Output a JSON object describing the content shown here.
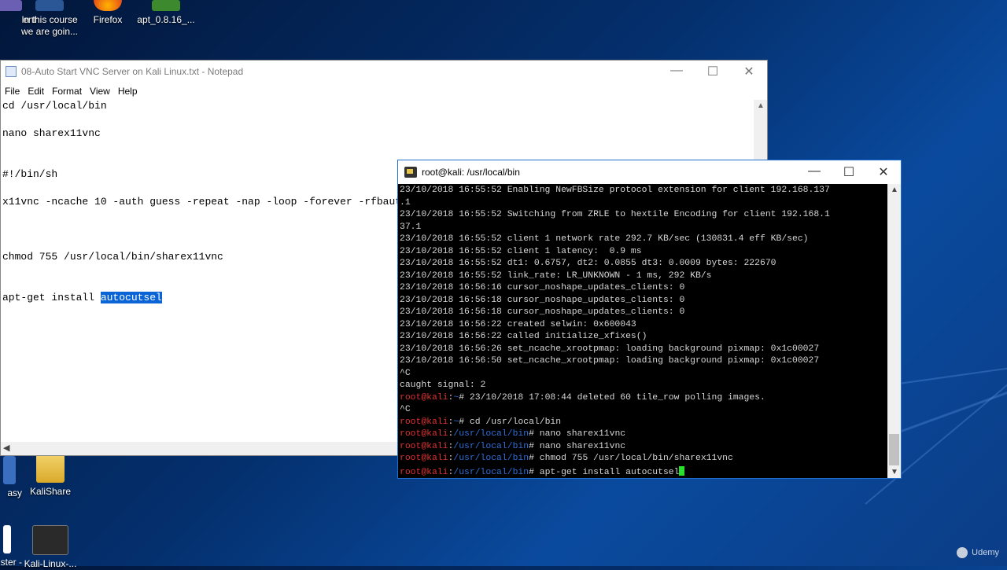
{
  "desktop": {
    "icons": [
      {
        "label": "ent",
        "icon": "document-icon"
      },
      {
        "label": "In this course we are goin...",
        "icon": "word-document-icon"
      },
      {
        "label": "Firefox",
        "icon": "firefox-icon"
      },
      {
        "label": "apt_0.8.16_...",
        "icon": "archive-icon"
      },
      {
        "label": "asy",
        "icon": "app-icon"
      },
      {
        "label": "KaliShare",
        "icon": "shared-folder-icon"
      },
      {
        "label": "ster -",
        "icon": "app-icon"
      },
      {
        "label": "Kali-Linux-...",
        "icon": "vm-image-icon"
      }
    ],
    "watermark": "Udemy"
  },
  "notepad": {
    "title": "08-Auto Start VNC Server on Kali Linux.txt - Notepad",
    "menu": [
      "File",
      "Edit",
      "Format",
      "View",
      "Help"
    ],
    "lines": [
      "cd /usr/local/bin",
      "nano sharex11vnc",
      "#!/bin/sh",
      "x11vnc -ncache 10 -auth guess -repeat -nap -loop -forever -rfbaut",
      "chmod 755 /usr/local/bin/sharex11vnc",
      "apt-get install "
    ],
    "selected_text": "autocutsel"
  },
  "terminal": {
    "title": "root@kali: /usr/local/bin",
    "log_lines": [
      "23/10/2018 16:55:52 Enabling NewFBSize protocol extension for client 192.168.137",
      ".1",
      "23/10/2018 16:55:52 Switching from ZRLE to hextile Encoding for client 192.168.1",
      "37.1",
      "23/10/2018 16:55:52 client 1 network rate 292.7 KB/sec (130831.4 eff KB/sec)",
      "23/10/2018 16:55:52 client 1 latency:  0.9 ms",
      "23/10/2018 16:55:52 dt1: 0.6757, dt2: 0.0855 dt3: 0.0009 bytes: 222670",
      "23/10/2018 16:55:52 link_rate: LR_UNKNOWN - 1 ms, 292 KB/s",
      "23/10/2018 16:56:16 cursor_noshape_updates_clients: 0",
      "23/10/2018 16:56:18 cursor_noshape_updates_clients: 0",
      "23/10/2018 16:56:18 cursor_noshape_updates_clients: 0",
      "23/10/2018 16:56:22 created selwin: 0x600043",
      "23/10/2018 16:56:22 called initialize_xfixes()",
      "23/10/2018 16:56:26 set_ncache_xrootpmap: loading background pixmap: 0x1c00027",
      "23/10/2018 16:56:50 set_ncache_xrootpmap: loading background pixmap: 0x1c00027",
      "^C",
      "caught signal: 2"
    ],
    "prompt_lines": [
      {
        "user": "root@kali",
        "path": "~",
        "cmd": " 23/10/2018 17:08:44 deleted 60 tile_row polling images."
      },
      {
        "user": "",
        "path": "",
        "cmd": "^C"
      },
      {
        "user": "root@kali",
        "path": "~",
        "cmd": " cd /usr/local/bin"
      },
      {
        "user": "root@kali",
        "path": "/usr/local/bin",
        "cmd": " nano sharex11vnc"
      },
      {
        "user": "root@kali",
        "path": "/usr/local/bin",
        "cmd": " nano sharex11vnc"
      },
      {
        "user": "root@kali",
        "path": "/usr/local/bin",
        "cmd": " chmod 755 /usr/local/bin/sharex11vnc"
      },
      {
        "user": "root@kali",
        "path": "/usr/local/bin",
        "cmd": " apt-get install autocutsel"
      }
    ]
  }
}
